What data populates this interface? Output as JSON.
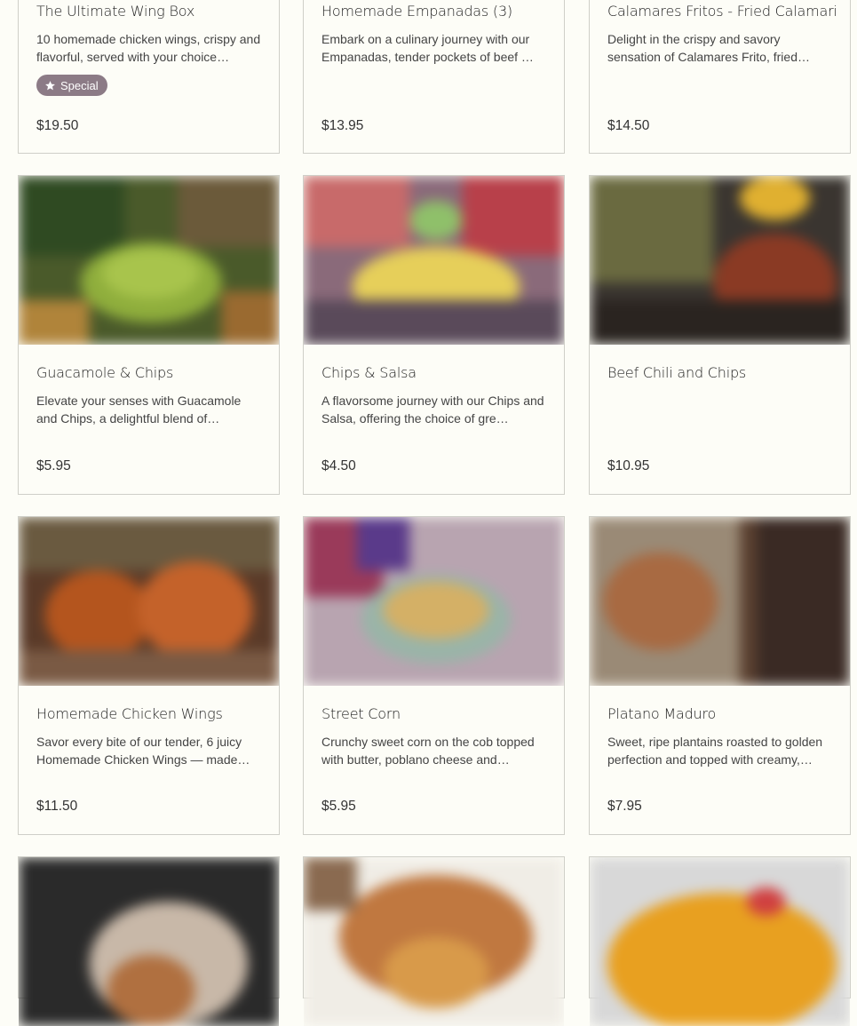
{
  "menu": {
    "items": [
      {
        "name": "The Ultimate Wing Box",
        "desc": "10 homemade chicken wings, crispy and flavorful, served with your choice…",
        "price": "$19.50",
        "badge": "Special"
      },
      {
        "name": "Homemade Empanadas (3)",
        "desc": "Embark on a culinary journey with our Empanadas, tender pockets of beef …",
        "price": "$13.95"
      },
      {
        "name": "Calamares Fritos - Fried Calamari",
        "desc": "Delight in the crispy and savory sensation of Calamares Frito, fried…",
        "price": "$14.50"
      },
      {
        "name": "Guacamole & Chips",
        "desc": "Elevate your senses with Guacamole and Chips, a delightful blend of…",
        "price": "$5.95"
      },
      {
        "name": "Chips & Salsa",
        "desc": "A flavorsome journey with our Chips and Salsa, offering the choice of gre…",
        "price": "$4.50"
      },
      {
        "name": "Beef Chili and Chips",
        "desc": "",
        "price": "$10.95"
      },
      {
        "name": "Homemade Chicken Wings",
        "desc": "Savor every bite of our tender, 6 juicy Homemade Chicken Wings — made…",
        "price": "$11.50"
      },
      {
        "name": "Street Corn",
        "desc": "Crunchy sweet corn on the cob topped with butter, poblano cheese and…",
        "price": "$5.95"
      },
      {
        "name": "Platano Maduro",
        "desc": "Sweet, ripe plantains roasted to golden perfection and topped with creamy,…",
        "price": "$7.95"
      }
    ]
  },
  "icons": {
    "badge": "star-icon"
  },
  "colors": {
    "background": "#fdfdf7",
    "badge": "#8c7b86",
    "border": "#cfcfc8"
  }
}
